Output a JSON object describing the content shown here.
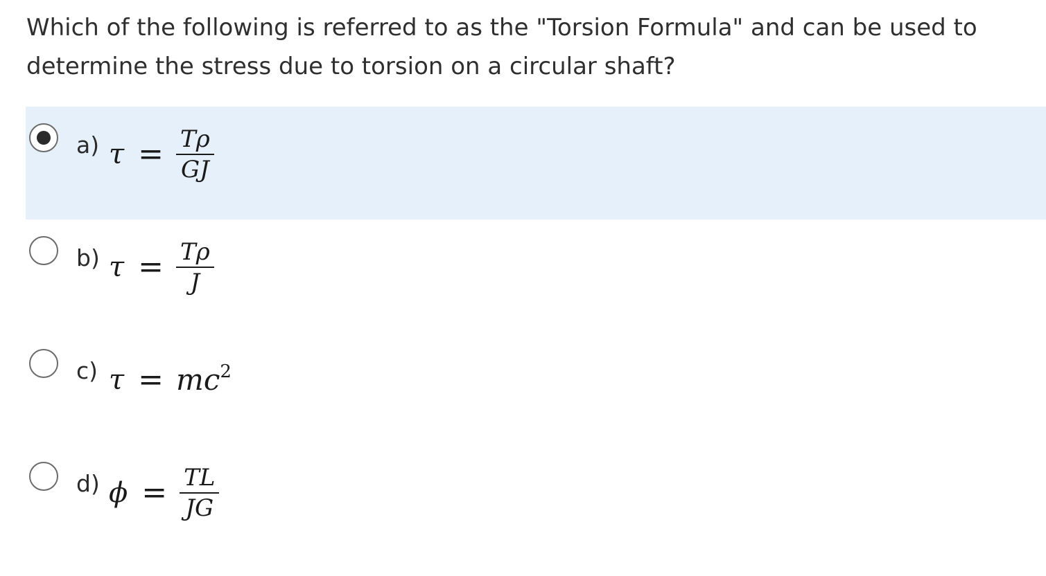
{
  "question": "Which of the following is referred to as the \"Torsion Formula\" and can be used to determine the stress due to torsion on a circular shaft?",
  "options": [
    {
      "letter": "a)",
      "lhs": "τ",
      "eq": "=",
      "num": "Tρ",
      "den": "GJ",
      "selected": true
    },
    {
      "letter": "b)",
      "lhs": "τ",
      "eq": "=",
      "num": "Tρ",
      "den": "J",
      "selected": false
    },
    {
      "letter": "c)",
      "lhs": "τ",
      "eq": "=",
      "expr": "mc",
      "exp": "2",
      "selected": false
    },
    {
      "letter": "d)",
      "lhs": "ϕ",
      "eq": "=",
      "num": "TL",
      "den": "JG",
      "selected": false
    }
  ],
  "colors": {
    "selected_bg": "#e6f0fb",
    "text": "#2b2b2b"
  }
}
